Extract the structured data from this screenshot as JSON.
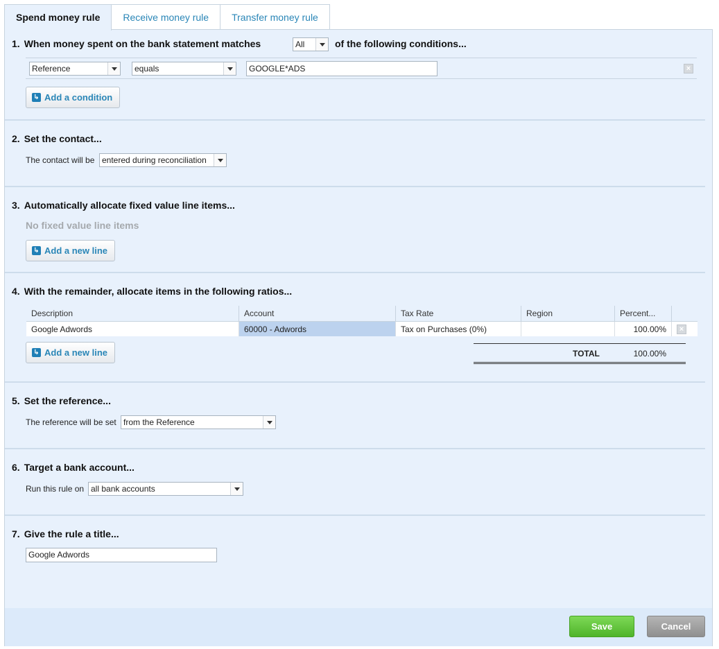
{
  "tabs": [
    "Spend money rule",
    "Receive money rule",
    "Transfer money rule"
  ],
  "s1": {
    "num": "1.",
    "title_pre": "When money spent on the bank statement matches",
    "match_value": "All",
    "title_post": "of the following conditions...",
    "condition": {
      "field": "Reference",
      "operator": "equals",
      "value": "GOOGLE*ADS"
    },
    "add_label": "Add a condition"
  },
  "s2": {
    "num": "2.",
    "title": "Set the contact...",
    "label": "The contact will be",
    "value": "entered during reconciliation"
  },
  "s3": {
    "num": "3.",
    "title": "Automatically allocate fixed value line items...",
    "empty": "No fixed value line items",
    "add_label": "Add a new line"
  },
  "s4": {
    "num": "4.",
    "title": "With the remainder, allocate items in the following ratios...",
    "columns": [
      "Description",
      "Account",
      "Tax Rate",
      "Region",
      "Percent..."
    ],
    "rows": [
      {
        "description": "Google Adwords",
        "account": "60000 - Adwords",
        "tax": "Tax on Purchases (0%)",
        "region": "",
        "percent": "100.00%"
      }
    ],
    "add_label": "Add a new line",
    "total_label": "TOTAL",
    "total_value": "100.00%"
  },
  "s5": {
    "num": "5.",
    "title": "Set the reference...",
    "label": "The reference will be set",
    "value": "from the Reference"
  },
  "s6": {
    "num": "6.",
    "title": "Target a bank account...",
    "label": "Run this rule on",
    "value": "all bank accounts"
  },
  "s7": {
    "num": "7.",
    "title": "Give the rule a title...",
    "value": "Google Adwords"
  },
  "footer": {
    "save": "Save",
    "cancel": "Cancel"
  }
}
